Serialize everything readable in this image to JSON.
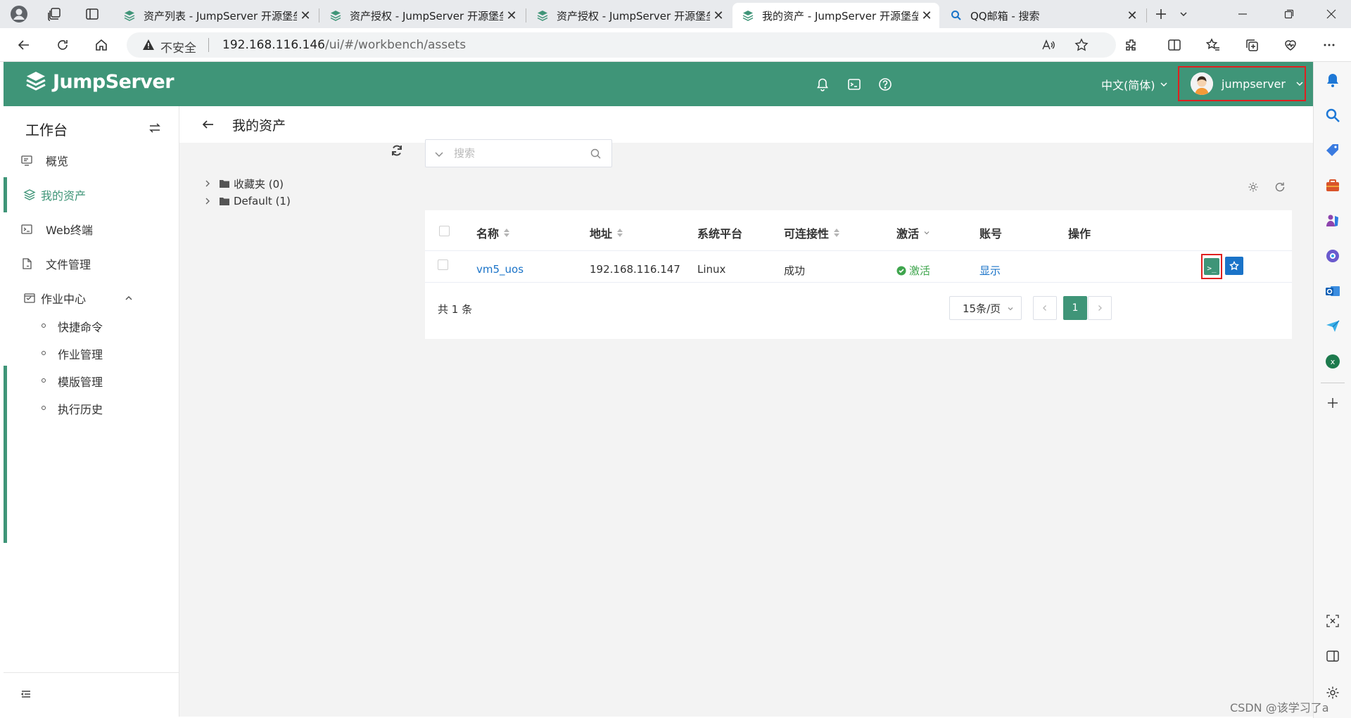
{
  "browser": {
    "tabs": [
      {
        "title": "资产列表 - JumpServer 开源堡垒机",
        "active": false,
        "favicon": "jumpserver-favicon"
      },
      {
        "title": "资产授权 - JumpServer 开源堡垒机",
        "active": false,
        "favicon": "jumpserver-favicon"
      },
      {
        "title": "资产授权 - JumpServer 开源堡垒机",
        "active": false,
        "favicon": "jumpserver-favicon"
      },
      {
        "title": "我的资产 - JumpServer 开源堡垒机",
        "active": true,
        "favicon": "jumpserver-favicon"
      },
      {
        "title": "QQ邮箱 - 搜索",
        "active": false,
        "favicon": "search-favicon"
      }
    ],
    "security_label": "不安全",
    "url_host": "192.168.116.146",
    "url_path": "/ui/#/workbench/assets"
  },
  "header": {
    "brand": "JumpServer",
    "language": "中文(简体)",
    "username": "jumpserver"
  },
  "sidebar": {
    "title": "工作台",
    "items": [
      {
        "label": "概览",
        "icon": "monitor-icon",
        "active": false
      },
      {
        "label": "我的资产",
        "icon": "layers-icon",
        "active": true
      },
      {
        "label": "Web终端",
        "icon": "terminal-icon",
        "active": false
      },
      {
        "label": "文件管理",
        "icon": "file-icon",
        "active": false
      },
      {
        "label": "作业中心",
        "icon": "job-icon",
        "active": false,
        "expanded": true
      }
    ],
    "subitems": [
      "快捷命令",
      "作业管理",
      "模版管理",
      "执行历史"
    ]
  },
  "page": {
    "title": "我的资产"
  },
  "tree": {
    "nodes": [
      {
        "label": "收藏夹 (0)"
      },
      {
        "label": "Default (1)"
      }
    ]
  },
  "search": {
    "placeholder": "搜索"
  },
  "table": {
    "columns": [
      "名称",
      "地址",
      "系统平台",
      "可连接性",
      "激活",
      "账号",
      "操作"
    ],
    "rows": [
      {
        "name": "vm5_uos",
        "address": "192.168.116.147",
        "platform": "Linux",
        "connectivity": "成功",
        "active": "激活",
        "account": "显示"
      }
    ],
    "terminal_glyph": ">_"
  },
  "pagination": {
    "total": "共 1 条",
    "page_size": "15条/页",
    "current_page": "1"
  },
  "watermark": "CSDN @该学习了a",
  "colors": {
    "brand_green": "#3f9578",
    "link_blue": "#1a73c8",
    "highlight_red": "#e02020"
  }
}
